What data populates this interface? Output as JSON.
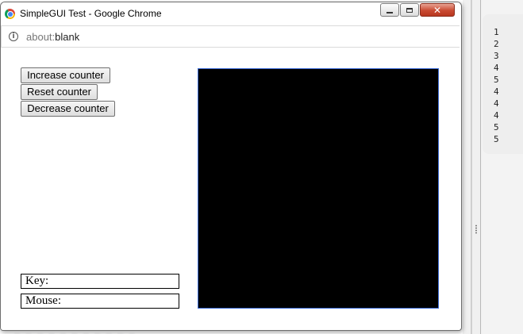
{
  "window": {
    "title": "SimpleGUI Test - Google Chrome",
    "minimize_glyph": "–",
    "maximize_glyph": "□",
    "close_glyph": "✕"
  },
  "addressbar": {
    "url_scheme": "about:",
    "url_rest": "blank",
    "info_icon_glyph": "i"
  },
  "controls": {
    "increase_label": "Increase counter",
    "reset_label": "Reset counter",
    "decrease_label": "Decrease counter"
  },
  "status": {
    "key_label": "Key:",
    "mouse_label": "Mouse:"
  },
  "canvas": {
    "background": "#000000"
  },
  "output": {
    "lines": [
      "1",
      "2",
      "3",
      "4",
      "5",
      "4",
      "4",
      "4",
      "5",
      "5"
    ]
  },
  "colors": {
    "close_button": "#c94a32",
    "canvas_border": "#3b6bd6"
  }
}
